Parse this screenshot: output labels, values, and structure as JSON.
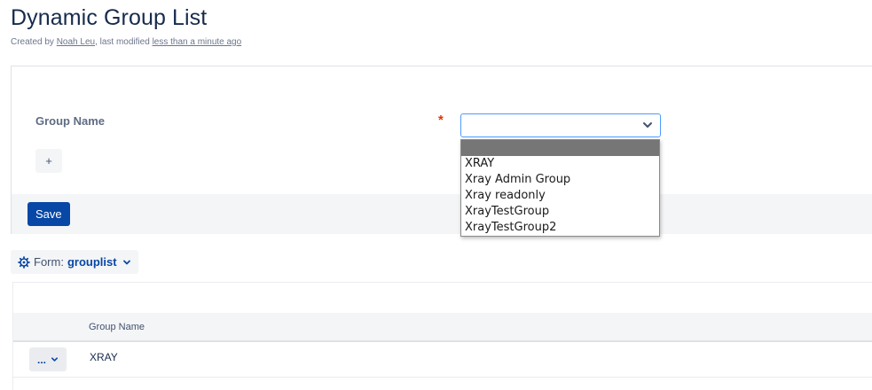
{
  "page": {
    "title": "Dynamic Group List",
    "byline": {
      "prefix": "Created by ",
      "author": "Noah Leu",
      "middle": ", last modified ",
      "modified": "less than a minute ago"
    }
  },
  "form": {
    "field_label": "Group Name",
    "required_mark": "*",
    "select_value": "",
    "dropdown_options": [
      "",
      "XRAY",
      "Xray Admin Group",
      "Xray readonly",
      "XrayTestGroup",
      "XrayTestGroup2"
    ],
    "add_label": "+",
    "save_label": "Save"
  },
  "form_chip": {
    "prefix": "Form:",
    "name": "grouplist"
  },
  "table": {
    "columns": [
      "Group Name"
    ],
    "rows": [
      {
        "action_label": "...",
        "group_name": "XRAY"
      }
    ]
  },
  "icons": {
    "select": "chevron-down-icon",
    "form_chip": "gear-icon",
    "row_action": "chevron-down-icon"
  },
  "colors": {
    "primary": "#0747a6",
    "required": "#de350b",
    "focus_border": "#4c9aff",
    "panel_bg": "#f4f5f7"
  }
}
